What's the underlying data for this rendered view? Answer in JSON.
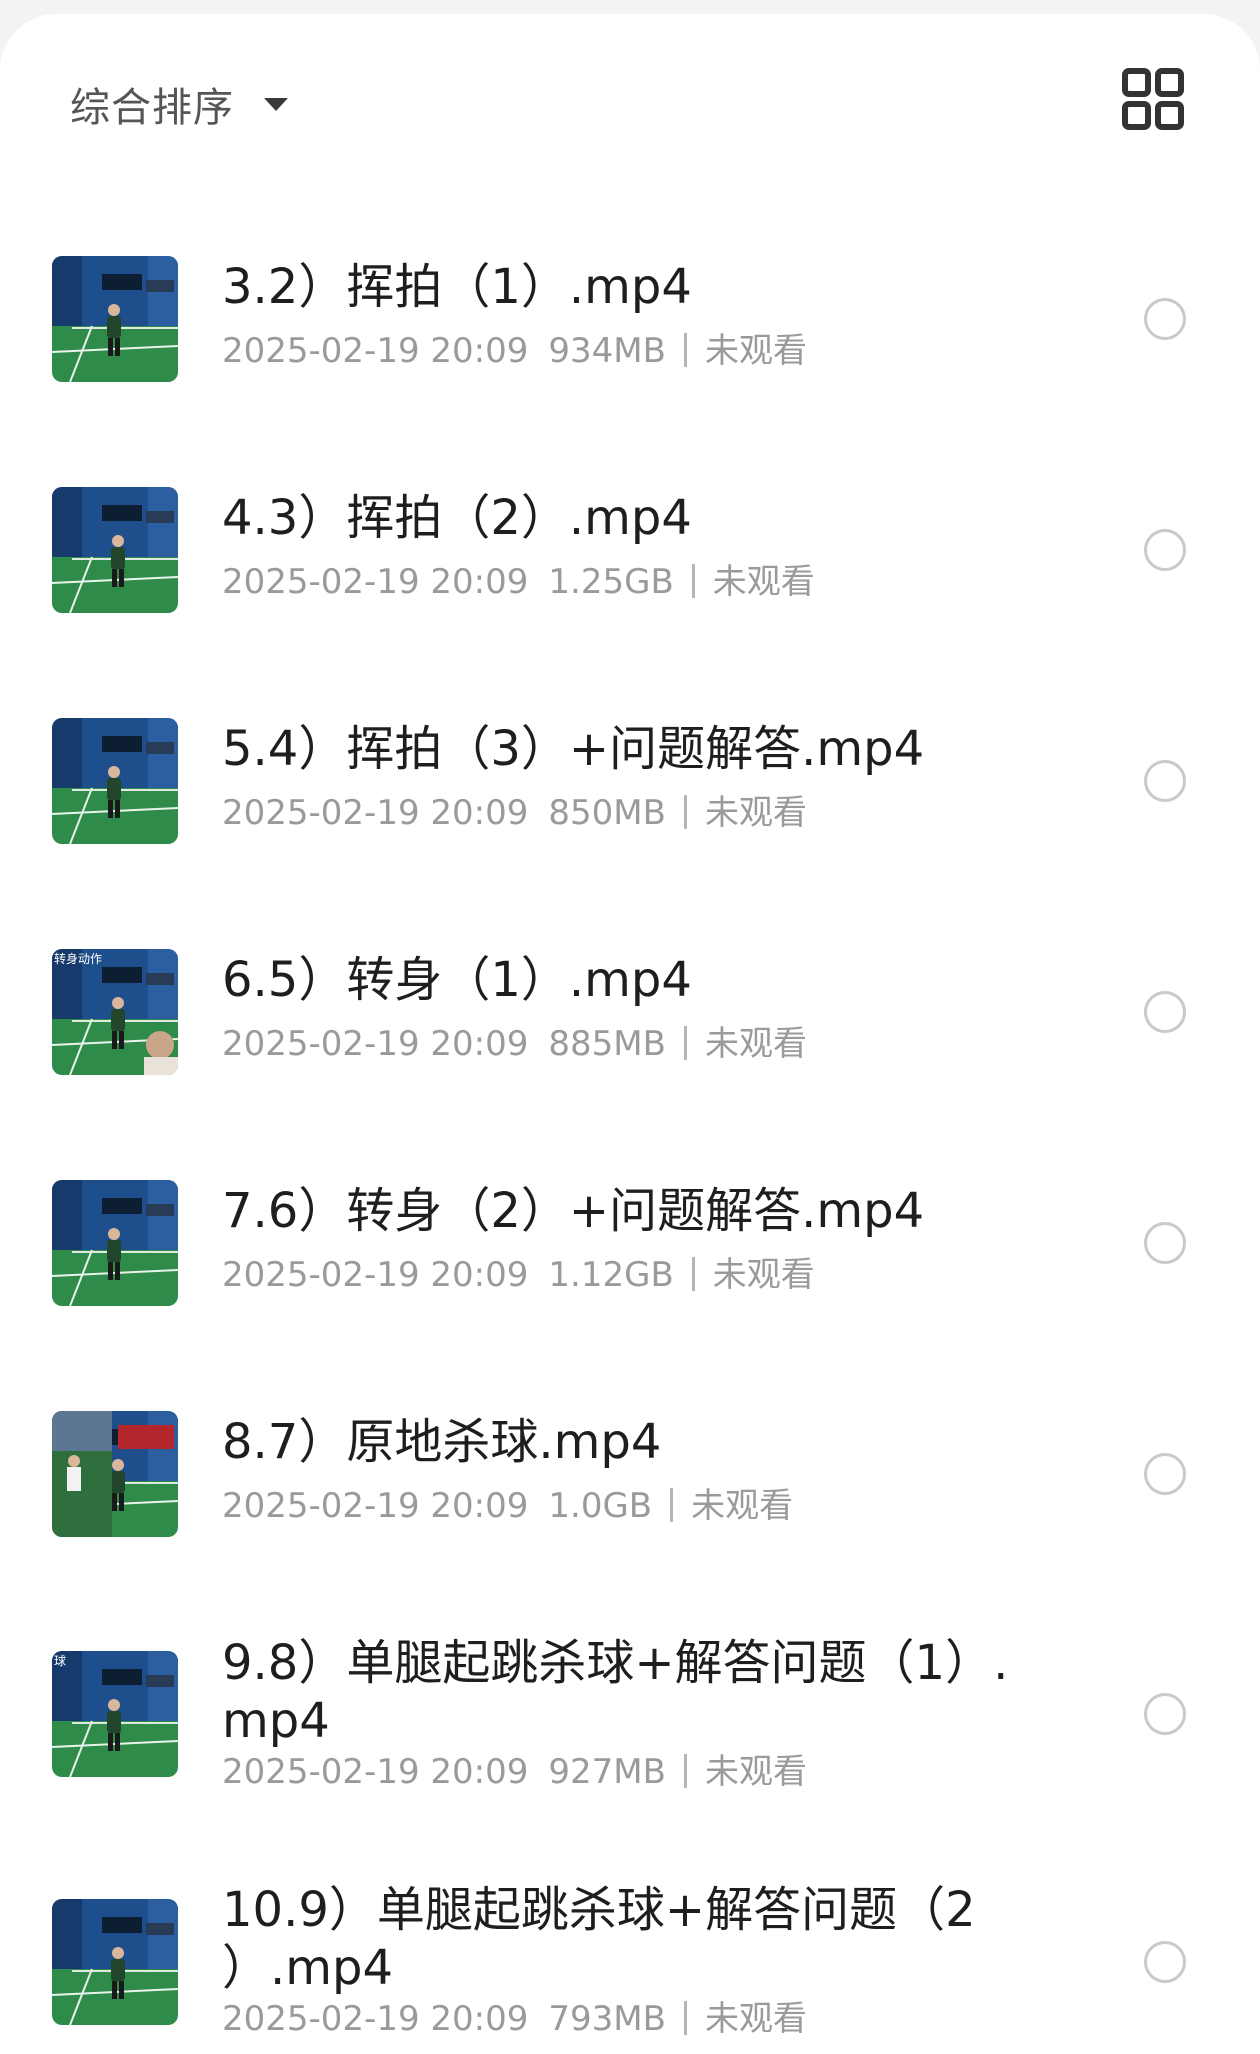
{
  "toolbar": {
    "sort_label": "综合排序",
    "sort_icon": "caret-down-icon",
    "view_toggle_icon": "grid-view-icon"
  },
  "colors": {
    "court_green": "#2e8b4a",
    "wall_blue": "#1f4e8c",
    "text_primary": "#1e1e1e",
    "text_secondary": "#9a9a9a"
  },
  "files": [
    {
      "title_lines": [
        "3.2）挥拍（1）.mp4"
      ],
      "date": "2025-02-19 20:09",
      "size": "934MB",
      "status": "未观看"
    },
    {
      "title_lines": [
        "4.3）挥拍（2）.mp4"
      ],
      "date": "2025-02-19 20:09",
      "size": "1.25GB",
      "status": "未观看"
    },
    {
      "title_lines": [
        "5.4）挥拍（3）+问题解答.mp4"
      ],
      "date": "2025-02-19 20:09",
      "size": "850MB",
      "status": "未观看"
    },
    {
      "title_lines": [
        "6.5）转身（1）.mp4"
      ],
      "date": "2025-02-19 20:09",
      "size": "885MB",
      "status": "未观看",
      "thumb_caption": "转身动作"
    },
    {
      "title_lines": [
        "7.6）转身（2）+问题解答.mp4"
      ],
      "date": "2025-02-19 20:09",
      "size": "1.12GB",
      "status": "未观看"
    },
    {
      "title_lines": [
        "8.7）原地杀球.mp4"
      ],
      "date": "2025-02-19 20:09",
      "size": "1.0GB",
      "status": "未观看"
    },
    {
      "title_lines": [
        "9.8）单腿起跳杀球+解答问题（1）.",
        "mp4"
      ],
      "date": "2025-02-19 20:09",
      "size": "927MB",
      "status": "未观看",
      "thumb_caption": "球"
    },
    {
      "title_lines": [
        "10.9）单腿起跳杀球+解答问题（2",
        "）.mp4"
      ],
      "date": "2025-02-19 20:09",
      "size": "793MB",
      "status": "未观看"
    }
  ]
}
